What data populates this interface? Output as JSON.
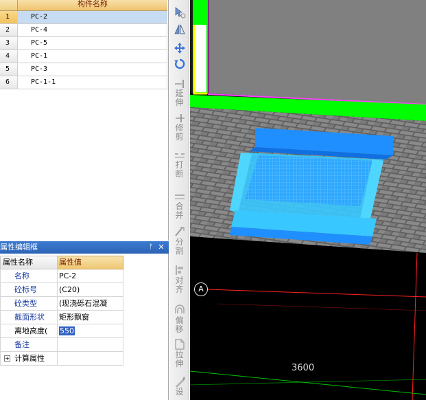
{
  "component_list": {
    "header": "构件名称",
    "rows": [
      {
        "index": "1",
        "name": "PC-2"
      },
      {
        "index": "2",
        "name": "PC-4"
      },
      {
        "index": "3",
        "name": "PC-5"
      },
      {
        "index": "4",
        "name": "PC-1"
      },
      {
        "index": "5",
        "name": "PC-3"
      },
      {
        "index": "6",
        "name": "PC-1-1"
      }
    ]
  },
  "property_panel": {
    "title": "属性编辑框",
    "pin_icon": "pin-icon",
    "close_icon": "close-icon",
    "col_name": "属性名称",
    "col_value": "属性值",
    "rows": [
      {
        "name": "名称",
        "value": "PC-2"
      },
      {
        "name": "砼标号",
        "value": "(C20)"
      },
      {
        "name": "砼类型",
        "value": "(现浇砾石混凝"
      },
      {
        "name": "截面形状",
        "value": "矩形飘窗"
      },
      {
        "name": "离地高度(",
        "value": "550"
      },
      {
        "name": "备注",
        "value": ""
      },
      {
        "name": "计算属性",
        "value": ""
      }
    ]
  },
  "toolbar": {
    "tools": [
      {
        "icon": "select-icon",
        "label": ""
      },
      {
        "icon": "mirror-icon",
        "label": ""
      },
      {
        "icon": "move-icon",
        "label": ""
      },
      {
        "icon": "rotate-icon",
        "label": ""
      },
      {
        "icon": "extend-icon",
        "label": "延伸"
      },
      {
        "icon": "trim-icon",
        "label": "修剪"
      },
      {
        "icon": "break-icon",
        "label": "打断"
      },
      {
        "icon": "merge-icon",
        "label": "合并"
      },
      {
        "icon": "split-icon",
        "label": "分割"
      },
      {
        "icon": "align-icon",
        "label": "对齐"
      },
      {
        "icon": "offset-icon",
        "label": "偏移"
      },
      {
        "icon": "stretch-icon",
        "label": "拉伸"
      },
      {
        "icon": "settings-icon",
        "label": "设"
      }
    ]
  },
  "viewport": {
    "axis_label": "A",
    "dimension_label": "3600",
    "colors": {
      "wall_green": "#00ff00",
      "wall_magenta": "#ff40ff",
      "wall_yellow": "#ffff00",
      "window_blue": "#1f8fff",
      "window_cyan": "#38c8ff",
      "grid_red": "#ff2020",
      "grid_green": "#00c000",
      "brick": "#6a6a6a",
      "floor": "#808080"
    }
  }
}
